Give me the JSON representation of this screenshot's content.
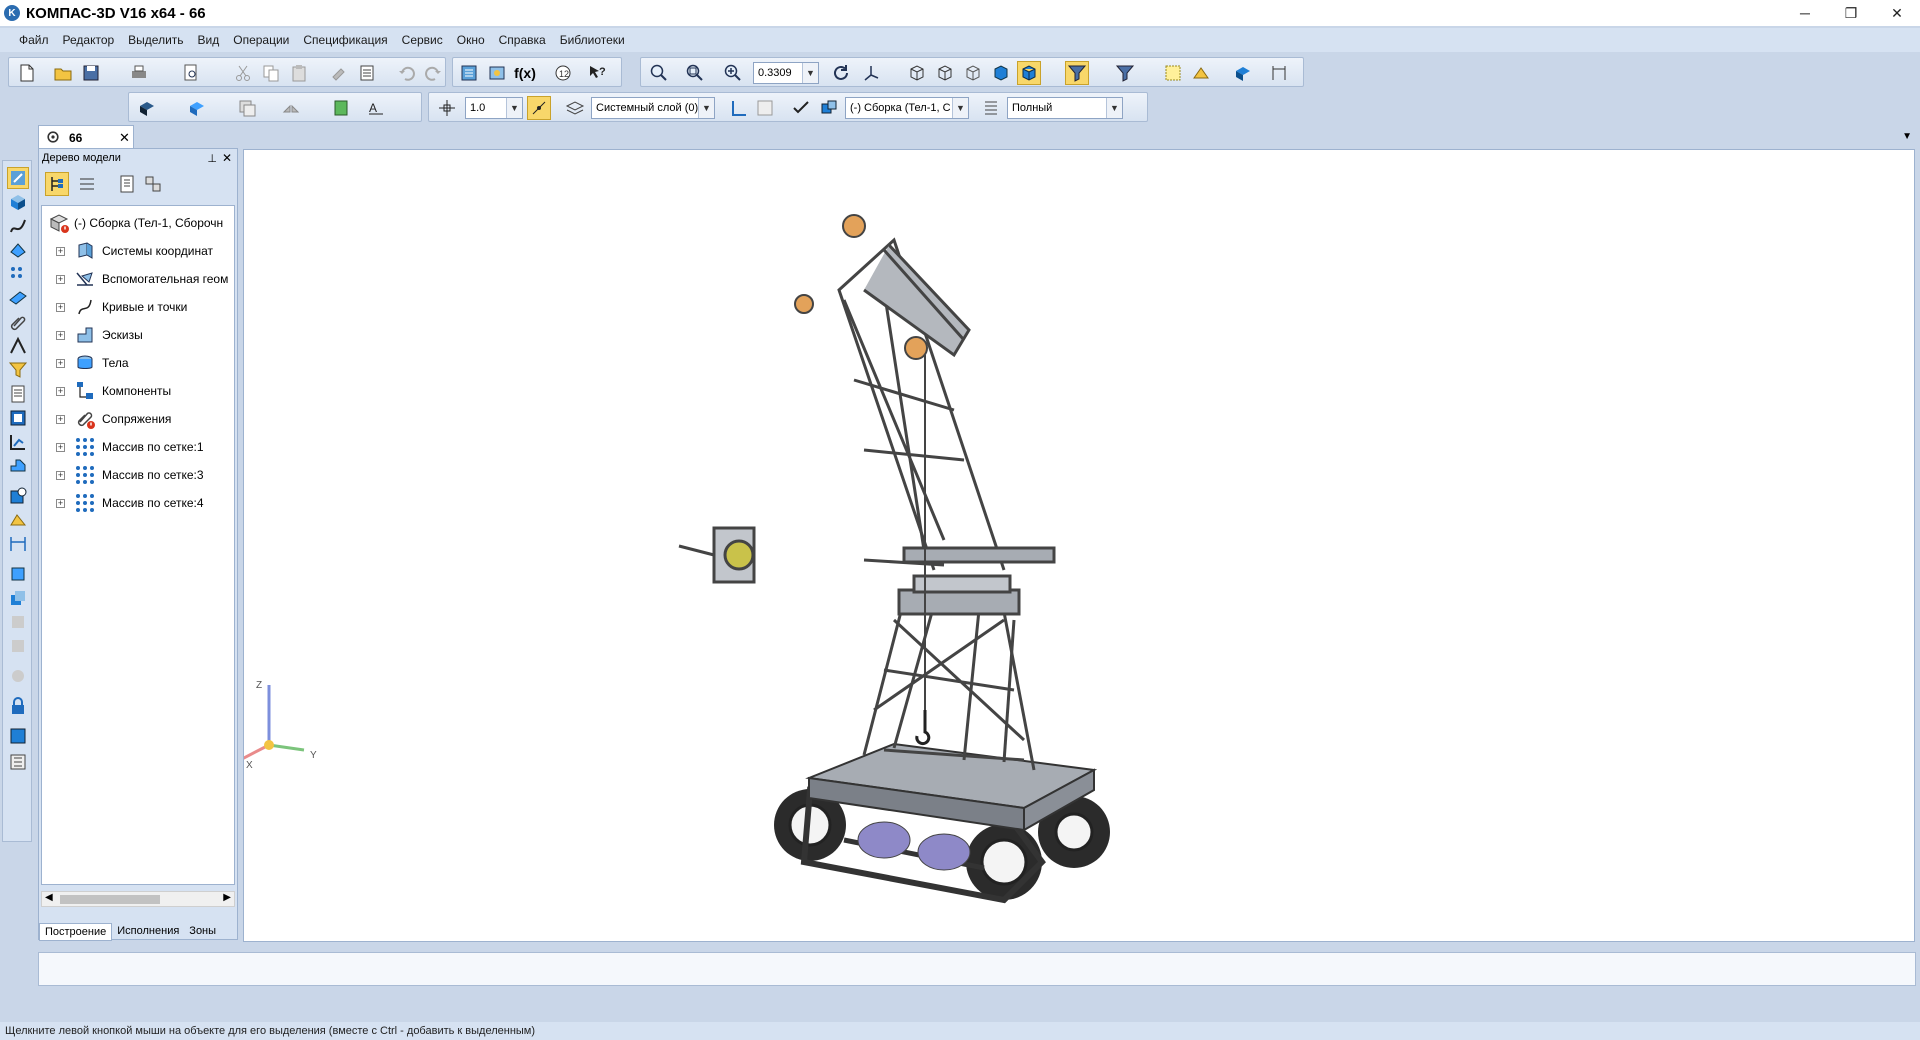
{
  "window": {
    "title": "КОМПАС-3D V16  x64 - 66",
    "controls": {
      "minimize": "─",
      "restore": "❐",
      "close": "✕"
    }
  },
  "menu": [
    {
      "label": "Файл"
    },
    {
      "label": "Редактор"
    },
    {
      "label": "Выделить"
    },
    {
      "label": "Вид"
    },
    {
      "label": "Операции"
    },
    {
      "label": "Спецификация"
    },
    {
      "label": "Сервис"
    },
    {
      "label": "Окно"
    },
    {
      "label": "Справка"
    },
    {
      "label": "Библиотеки"
    }
  ],
  "toolbar": {
    "zoom_value": "0.3309",
    "step_value": "1.0",
    "layer_value": "Системный слой (0)",
    "assembly_value": "(-) Сборка (Тел-1, С",
    "display_mode_value": "Полный",
    "fx_label": "f(x)"
  },
  "document_tab": {
    "label": "66",
    "close": "✕"
  },
  "tree_panel": {
    "title": "Дерево модели",
    "pin": "⊥",
    "close": "✕",
    "root": "(-) Сборка (Тел-1, Сборочн",
    "items": [
      {
        "label": "Системы координат",
        "icon": "coordinate-systems-icon"
      },
      {
        "label": "Вспомогательная геом",
        "icon": "auxiliary-geometry-icon"
      },
      {
        "label": "Кривые и точки",
        "icon": "curves-points-icon"
      },
      {
        "label": "Эскизы",
        "icon": "sketches-icon"
      },
      {
        "label": "Тела",
        "icon": "bodies-icon"
      },
      {
        "label": "Компоненты",
        "icon": "components-icon"
      },
      {
        "label": "Сопряжения",
        "icon": "mates-icon"
      },
      {
        "label": "Массив по сетке:1",
        "icon": "grid-array-icon"
      },
      {
        "label": "Массив по сетке:3",
        "icon": "grid-array-icon"
      },
      {
        "label": "Массив по сетке:4",
        "icon": "grid-array-icon"
      }
    ],
    "tabs": [
      {
        "label": "Построение",
        "active": true
      },
      {
        "label": "Исполнения",
        "active": false
      },
      {
        "label": "Зоны",
        "active": false
      }
    ]
  },
  "axes": {
    "z": "Z",
    "x": "X",
    "y": "Y"
  },
  "status": "Щелкните левой кнопкой мыши на объекте для его выделения (вместе с Ctrl - добавить к выделенным)",
  "colors": {
    "accent": "#2b6cb0",
    "panel_bg": "#d6e2f2",
    "app_bg": "#c9d6e8",
    "crane_metal": "#9aa0a8",
    "crane_orange": "#e3a25a",
    "track_purple": "#8e89c8"
  }
}
